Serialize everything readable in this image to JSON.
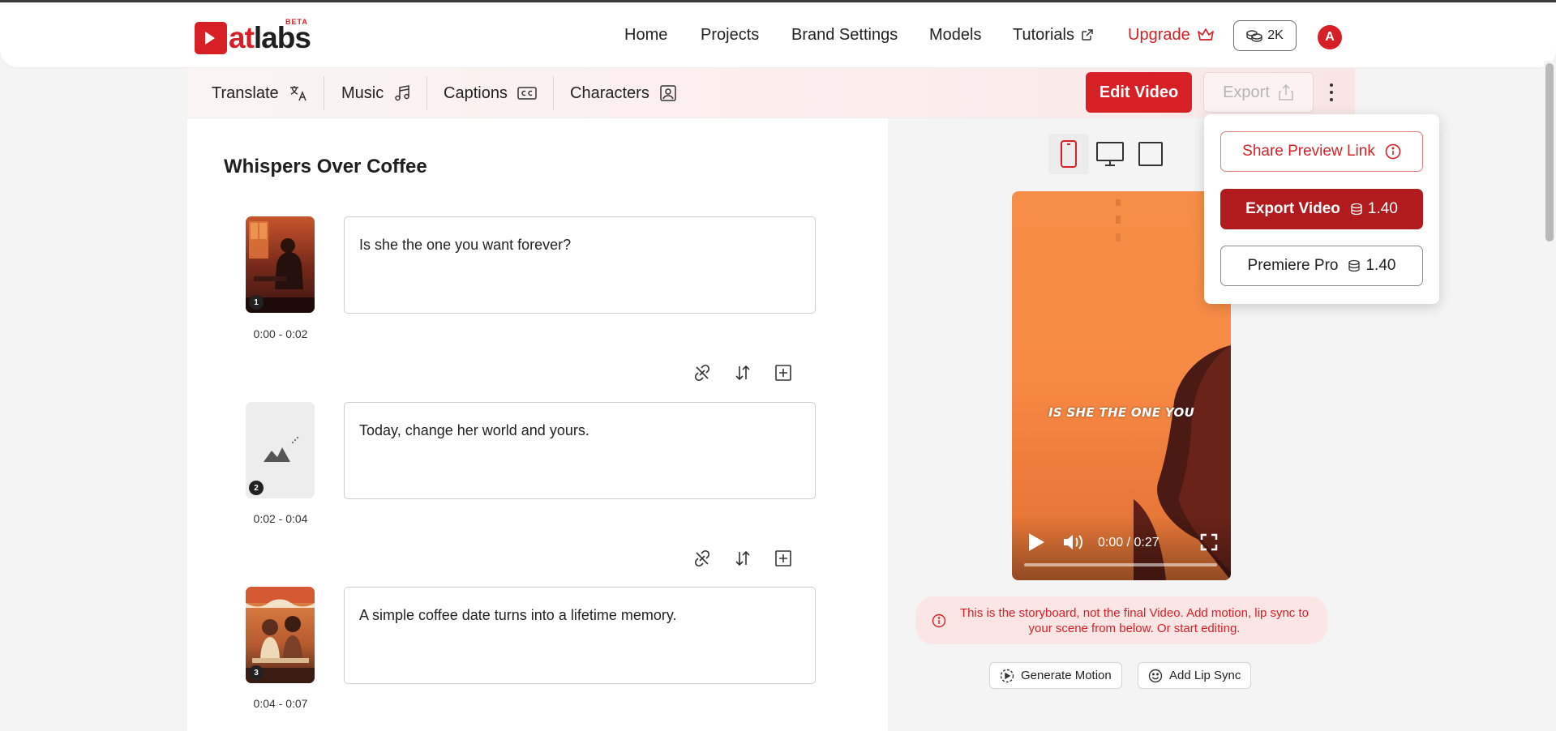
{
  "brand": {
    "name_prefix": "at",
    "name_suffix": "labs",
    "badge": "BETA",
    "accent": "#d71f26"
  },
  "nav": {
    "home": "Home",
    "projects": "Projects",
    "brand_settings": "Brand Settings",
    "models": "Models",
    "tutorials": "Tutorials",
    "upgrade": "Upgrade",
    "credits": "2K",
    "avatar_initial": "A"
  },
  "toolbar": {
    "translate": "Translate",
    "music": "Music",
    "captions": "Captions",
    "characters": "Characters",
    "edit_video": "Edit Video",
    "export": "Export"
  },
  "project": {
    "title": "Whispers Over Coffee"
  },
  "scenes": [
    {
      "number": "1",
      "time": "0:00 - 0:02",
      "text": "Is she the one you want forever?"
    },
    {
      "number": "2",
      "time": "0:02 - 0:04",
      "text": "Today, change her world and yours."
    },
    {
      "number": "3",
      "time": "0:04 - 0:07",
      "text": "A simple coffee date turns into a lifetime memory."
    }
  ],
  "preview": {
    "caption": "IS SHE THE ONE YOU",
    "time": "0:00 / 0:27",
    "progress": 0
  },
  "notice": {
    "text": "This is the storyboard, not the final Video. Add motion, lip sync to your scene from below. Or start editing."
  },
  "actions": {
    "generate_motion": "Generate Motion",
    "add_lip_sync": "Add Lip Sync"
  },
  "export_menu": {
    "share_preview": "Share Preview Link",
    "export_video": "Export Video",
    "export_video_cost": "1.40",
    "premiere_pro": "Premiere Pro",
    "premiere_pro_cost": "1.40"
  }
}
